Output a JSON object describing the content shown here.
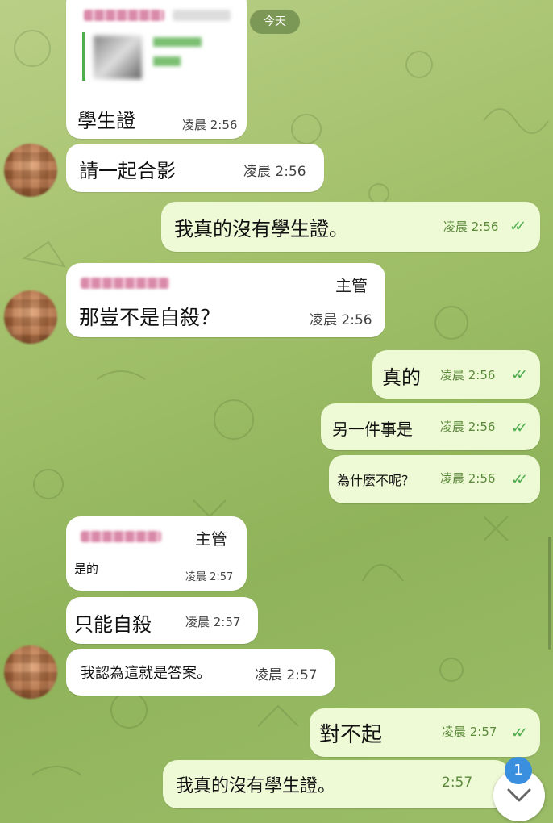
{
  "date_divider": "今天",
  "unread_count": "1",
  "messages": [
    {
      "direction": "in",
      "text": "學生證",
      "time": "凌晨 2:56"
    },
    {
      "direction": "in",
      "text": "請一起合影",
      "time": "凌晨 2:56"
    },
    {
      "direction": "out",
      "text": "我真的沒有學生證。",
      "time": "凌晨 2:56"
    },
    {
      "direction": "in",
      "role": "主管",
      "text": "那豈不是自殺？",
      "time": "凌晨 2:56"
    },
    {
      "direction": "out",
      "text": "真的",
      "time": "凌晨 2:56"
    },
    {
      "direction": "out",
      "text": "另一件事是",
      "time": "凌晨 2:56"
    },
    {
      "direction": "out",
      "text": "為什麼不呢？",
      "time": "凌晨 2:56"
    },
    {
      "direction": "in",
      "role": "主管",
      "text": "是的",
      "time": "凌晨 2:57"
    },
    {
      "direction": "in",
      "text": "只能自殺",
      "time": "凌晨 2:57"
    },
    {
      "direction": "in",
      "text": "我認為這就是答案。",
      "time": "凌晨 2:57"
    },
    {
      "direction": "out",
      "text": "對不起",
      "time": "凌晨 2:57"
    },
    {
      "direction": "out",
      "text": "我真的沒有學生證。",
      "time": "2:57"
    }
  ],
  "icons": {
    "read_receipt": "double-check-icon",
    "scroll_down": "chevron-down-icon"
  },
  "colors": {
    "incoming": "#ffffff",
    "outgoing": "#eef9d6",
    "check": "#4fae4e",
    "unread_badge": "#3a8fde"
  }
}
